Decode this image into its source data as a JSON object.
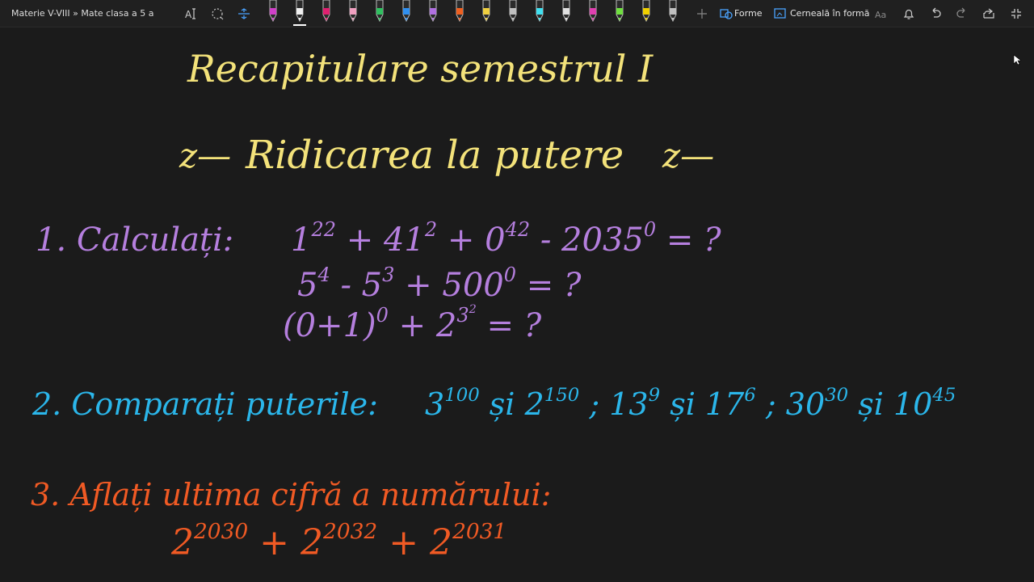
{
  "breadcrumb": "Materie V-VIII » Mate clasa a 5 a",
  "toolbar": {
    "shapes_label": "Forme",
    "ink_to_shape_label": "Cerneală în formă",
    "pen_colors": [
      "#d040c8",
      "#f0f0f0",
      "#e02070",
      "#f0a0c0",
      "#30c060",
      "#3090f0",
      "#b070e0",
      "#f06020",
      "#f0d040",
      "#c0c0c0",
      "#40e0f0",
      "#e0e0e0",
      "#e040b0",
      "#70e040",
      "#f0d000",
      "#c0c0c0"
    ],
    "icons": [
      "lasso-select-icon",
      "add-space-icon",
      "insert-space-icon",
      "pen-icon",
      "add-pen-icon",
      "shapes-icon",
      "ink-to-shape-icon",
      "ink-to-text-icon",
      "notifications-icon",
      "undo-icon",
      "redo-icon",
      "share-icon",
      "exit-fullscreen-icon"
    ]
  },
  "notes": {
    "title_line1": "Recapitulare semestrul I",
    "title_line2": "Ridicarea la putere",
    "title_deco": "z",
    "ex1_label": "1. Calculați:",
    "ex1_lines": [
      [
        [
          "1",
          "22"
        ],
        [
          "+ 41",
          "2"
        ],
        [
          "+ 0",
          "42"
        ],
        [
          "- 2035",
          "0"
        ],
        [
          "= ?",
          ""
        ]
      ],
      [
        [
          "5",
          "4"
        ],
        [
          "- 5",
          "3"
        ],
        [
          "+ 500",
          "0"
        ],
        [
          "= ?",
          ""
        ]
      ],
      [
        [
          "(0+1)",
          "0"
        ],
        [
          "+ 2",
          "3"
        ],
        [
          "",
          "2"
        ],
        [
          "= ?",
          ""
        ]
      ]
    ],
    "ex2_label": "2. Comparați puterile:",
    "ex2_items": [
      [
        "3",
        "100"
      ],
      [
        "și 2",
        "150"
      ],
      [
        ";  13",
        "9"
      ],
      [
        "și 17",
        "6"
      ],
      [
        ";  30",
        "30"
      ],
      [
        "și 10",
        "45"
      ]
    ],
    "ex3_label": "3. Aflați ultima cifră a numărului:",
    "ex3_terms": [
      [
        "2",
        "2030"
      ],
      [
        "+ 2",
        "2032"
      ],
      [
        "+ 2",
        "2031"
      ]
    ]
  },
  "colors": {
    "title": "#f3e27a",
    "ex1": "#b57fde",
    "ex2": "#2bb6ea",
    "ex3": "#f05a24",
    "background": "#1b1b1b"
  }
}
